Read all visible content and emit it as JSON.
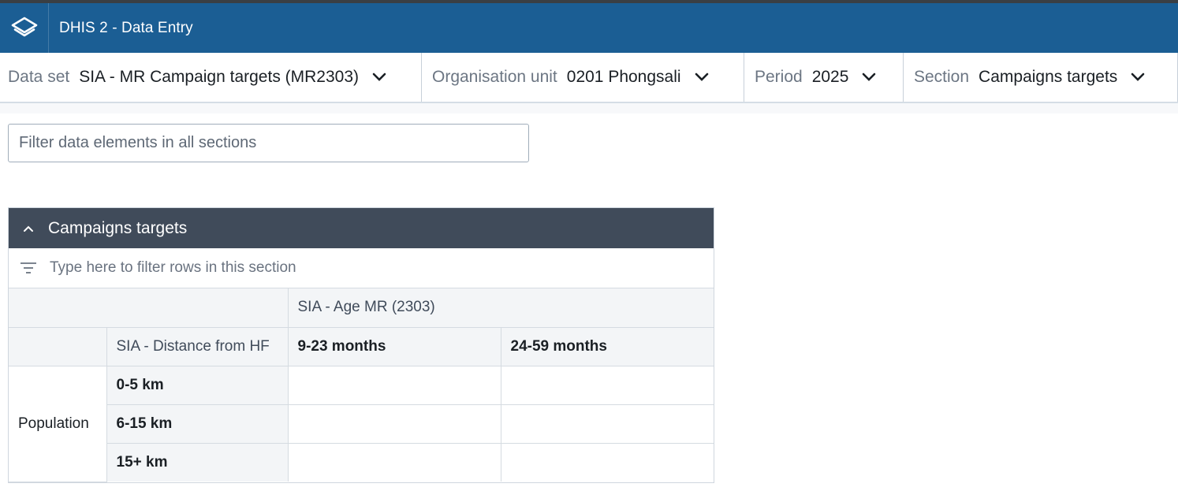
{
  "app": {
    "title": "DHIS 2 - Data Entry"
  },
  "selectors": {
    "dataset": {
      "label": "Data set",
      "value": "SIA - MR Campaign targets (MR2303)"
    },
    "orgunit": {
      "label": "Organisation unit",
      "value": "0201 Phongsali"
    },
    "period": {
      "label": "Period",
      "value": "2025"
    },
    "section": {
      "label": "Section",
      "value": "Campaigns targets"
    }
  },
  "filter_all": {
    "placeholder": "Filter data elements in all sections"
  },
  "section": {
    "title": "Campaigns targets",
    "filter_placeholder": "Type here to filter rows in this section",
    "category_header": "SIA - Age MR (2303)",
    "row_category_header": "SIA - Distance from HF",
    "columns": [
      "9-23 months",
      "24-59 months"
    ],
    "data_element": "Population",
    "rows": [
      "0-5 km",
      "6-15 km",
      "15+ km"
    ]
  },
  "colors": {
    "header": "#1b5e94",
    "section_header": "#404b5a"
  },
  "icons": [
    "dhis2-logo-icon",
    "chevron-down-icon",
    "chevron-up-icon",
    "filter-icon"
  ]
}
